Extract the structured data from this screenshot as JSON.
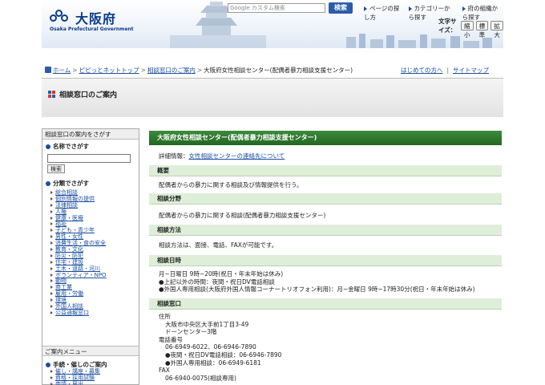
{
  "header": {
    "logo_text": "大阪府",
    "logo_sub": "Osaka Prefectural Government",
    "search_placeholder": "Google カスタム検索",
    "search_button": "検索",
    "top_links": [
      "ページの探し方",
      "カテゴリーから探す",
      "府の組織から探す"
    ],
    "fontsize_label": "文字サイズ：",
    "fontsize_buttons": [
      "縮小",
      "標準",
      "拡大"
    ]
  },
  "breadcrumb": {
    "items": [
      "ホーム",
      "ピピっとネットトップ",
      "相談窓口のご案内"
    ],
    "current": "大阪府女性相談センター(配偶者暴力相談支援センター)",
    "right_links": [
      "はじめての方へ",
      "サイトマップ"
    ]
  },
  "page_title": "相談窓口のご案内",
  "sidebar": {
    "heading": "相談窓口の案内をさがす",
    "name_search": "名称でさがす",
    "search_button": "検索",
    "category_search": "分類でさがす",
    "categories": [
      "総合相談",
      "個別情報の提供",
      "法律相談",
      "人権",
      "健康・医療",
      "福祉",
      "子ども・青少年",
      "男性・女性",
      "消費生活・食の安全",
      "教育・文化",
      "防災・防犯",
      "住宅・建設",
      "土木・道路・河川",
      "ボランティア・NPO",
      "動物",
      "商工業",
      "雇用・労働",
      "環境",
      "外国人相談",
      "公益通報窓口"
    ],
    "menu_heading": "ご案内メニュー",
    "menu_section": "手続・催しのご案内",
    "menu_items": [
      "催し・講座・募集",
      "資格・採用試験",
      "申請・届出"
    ]
  },
  "main": {
    "title": "大阪府女性相談センター(配偶者暴力相談支援センター)",
    "detail_prefix": "詳細情報：",
    "detail_link": "女性相談センターの連絡先について",
    "sections": [
      {
        "head": "概要",
        "lines": [
          "配偶者からの暴力に関する相談及び情報提供を行う。"
        ]
      },
      {
        "head": "相談分野",
        "lines": [
          "配偶者からの暴力に関する相談(配偶者暴力相談支援センター)"
        ]
      },
      {
        "head": "相談方法",
        "lines": [
          "相談方法は、面接、電話、FAXが可能です。"
        ]
      },
      {
        "head": "相談日時",
        "lines": [
          "月~日曜日 9時~20時(祝日・年末年始は休み)",
          "●上記以外の時間：夜間・祝日DV電話相談",
          "●外国人専用相談(大阪府外国人情報コーナートリオフォン利用)：月~金曜日 9時~17時30分(祝日・年末年始は休み)"
        ]
      }
    ],
    "window": {
      "head": "相談窓口",
      "address_label": "住所",
      "address": [
        "大阪市中央区大手前1丁目3-49",
        "ドーンセンター3階"
      ],
      "phone_label": "電話番号",
      "phones": [
        "06-6949-6022、06-6946-7890",
        "●夜間・祝日DV電話相談：06-6946-7890",
        "●外国人専用相談：06-6949-6181"
      ],
      "fax_label": "FAX",
      "fax": "06-6940-0075(相談専用)"
    }
  }
}
